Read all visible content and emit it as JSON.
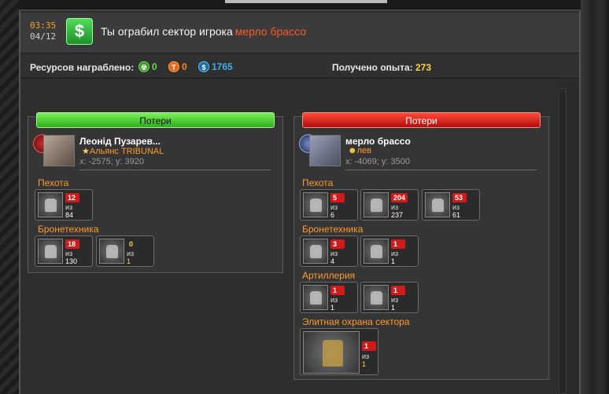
{
  "header": {
    "time": "03:35",
    "date": "04/12",
    "icon": "dollar-icon",
    "message": "Ты ограбил сектор игрока",
    "player": "мерло брассо"
  },
  "resources": {
    "label": "Ресурсов награблено:",
    "items": [
      {
        "icon": "radiation-icon",
        "value": "0",
        "color": "#6fd34a"
      },
      {
        "icon": "titanium-icon",
        "value": "0",
        "color": "#ff8a2a"
      },
      {
        "icon": "credits-icon",
        "value": "1765",
        "color": "#3fb3e8"
      }
    ],
    "exp_label": "Получено опыта:",
    "exp_value": "273"
  },
  "left": {
    "banner": "Потери",
    "name": "Леонід Пузарев...",
    "alliance": "Альянс TRIBUNAL",
    "coords": "x: -2575; y: 3920",
    "sections": [
      {
        "title": "Пехота",
        "units": [
          {
            "count": "12",
            "of": "из",
            "total": "84"
          }
        ]
      },
      {
        "title": "Бронетехника",
        "units": [
          {
            "count": "18",
            "of": "из",
            "total": "130"
          },
          {
            "count": "0",
            "of": "из",
            "total": "1"
          }
        ]
      }
    ]
  },
  "right": {
    "banner": "Потери",
    "name": "мерло брассо",
    "alliance": "лев",
    "coords": "x: -4069; y: 3500",
    "sections": [
      {
        "title": "Пехота",
        "units": [
          {
            "count": "5",
            "of": "из",
            "total": "6"
          },
          {
            "count": "204",
            "of": "из",
            "total": "237"
          },
          {
            "count": "53",
            "of": "из",
            "total": "61"
          }
        ]
      },
      {
        "title": "Бронетехника",
        "units": [
          {
            "count": "3",
            "of": "из",
            "total": "4"
          },
          {
            "count": "1",
            "of": "из",
            "total": "1"
          }
        ]
      },
      {
        "title": "Артиллерия",
        "units": [
          {
            "count": "1",
            "of": "из",
            "total": "1"
          },
          {
            "count": "1",
            "of": "из",
            "total": "1"
          }
        ]
      },
      {
        "title": "Элитная охрана сектора",
        "units": [
          {
            "count": "1",
            "of": "из",
            "total": "1"
          }
        ]
      }
    ]
  }
}
